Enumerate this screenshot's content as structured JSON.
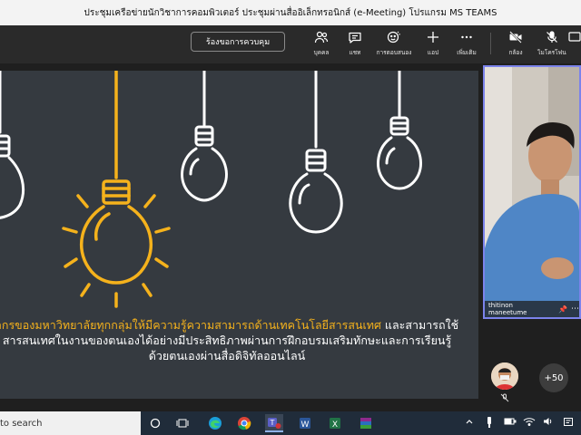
{
  "window": {
    "title": "ประชุมเครือข่ายนักวิชาการคอมพิวเตอร์ ประชุมผ่านสื่ออิเล็กทรอนิกส์ (e-Meeting) โปรแกรม MS TEAMS"
  },
  "toolbar": {
    "request_control": "ร้องขอการควบคุม",
    "items": [
      {
        "label": "บุคคล",
        "icon": "people-icon"
      },
      {
        "label": "แชท",
        "icon": "chat-icon"
      },
      {
        "label": "การตอบสนอง",
        "icon": "reactions-icon"
      },
      {
        "label": "แอป",
        "icon": "add-apps-icon"
      },
      {
        "label": "เพิ่มเติม",
        "icon": "more-icon"
      },
      {
        "label": "กล้อง",
        "icon": "camera-off-icon"
      },
      {
        "label": "ไมโครโฟน",
        "icon": "mic-off-icon"
      }
    ]
  },
  "slide": {
    "highlight_text": "ากรของมหาวิทยาลัยทุกกลุ่มให้มีความรู้ความสามารถด้านเทคโนโลยีสารสนเทศ",
    "line1_rest": " และสามารถใช้",
    "line2": "สารสนเทศในงานของตนเองได้อย่างมีประสิทธิภาพผ่านการฝึกอบรมเสริมทักษะและการเรียนรู้",
    "line3": "ด้วยตนเองผ่านสื่อดิจิทัลออนไลน์",
    "colors": {
      "background": "#353a40",
      "highlight": "#f5b21c",
      "bulb_outline": "#ffffff"
    }
  },
  "participant": {
    "name": "thitinon maneetume"
  },
  "gallery": {
    "more_count": "+50"
  },
  "taskbar": {
    "search_text": "to search"
  },
  "colors": {
    "accent": "#7b83eb",
    "toolbar_bg": "#2a2a2a",
    "taskbar_bg": "#202c3a"
  }
}
